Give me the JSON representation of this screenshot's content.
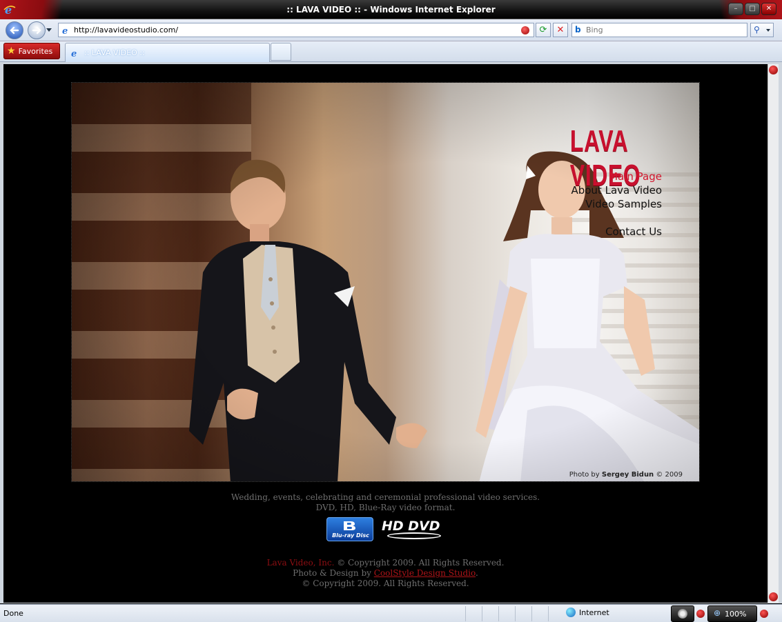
{
  "window": {
    "title": ":: LAVA VIDEO :: - Windows Internet Explorer",
    "min_icon": "minimize-icon",
    "max_icon": "maximize-icon",
    "close_icon": "close-icon"
  },
  "address_bar": {
    "url": "http://lavavideostudio.com/",
    "search_placeholder": "Bing"
  },
  "tabs": {
    "favorites_label": "Favorites",
    "active_tab_label": ":: LAVA VIDEO ::"
  },
  "page": {
    "logo": "LAVA VIDEO",
    "nav": [
      {
        "label": "Main Page",
        "active": true
      },
      {
        "label": "About Lava Video",
        "active": false
      },
      {
        "label": "Video Samples",
        "active": false
      },
      {
        "label": "Contact Us",
        "active": false
      }
    ],
    "credit_prefix": "Photo by ",
    "credit_name": "Sergey Bidun",
    "credit_suffix": " © 2009",
    "services_line1": "Wedding, events, celebrating and ceremonial professional video services.",
    "services_line2": "DVD, HD, Blue-Ray video format.",
    "bluray_label": "Blu-ray Disc",
    "hddvd_label": "HD DVD",
    "copyright_brand": "Lava Video, Inc.",
    "copyright_line1_rest": " © Copyright 2009. All Rights Reserved.",
    "design_prefix": "Photo & Design by ",
    "design_link": "CoolStyle Design Studio",
    "design_suffix": ".",
    "copyright_line3": "© Copyright 2009. All Rights Reserved."
  },
  "status_bar": {
    "status": "Done",
    "zone": "Internet",
    "zoom": "100%"
  },
  "colors": {
    "accent_red": "#c8102e",
    "nav_active": "#d3172e",
    "footer_text": "#6e6e6e"
  }
}
